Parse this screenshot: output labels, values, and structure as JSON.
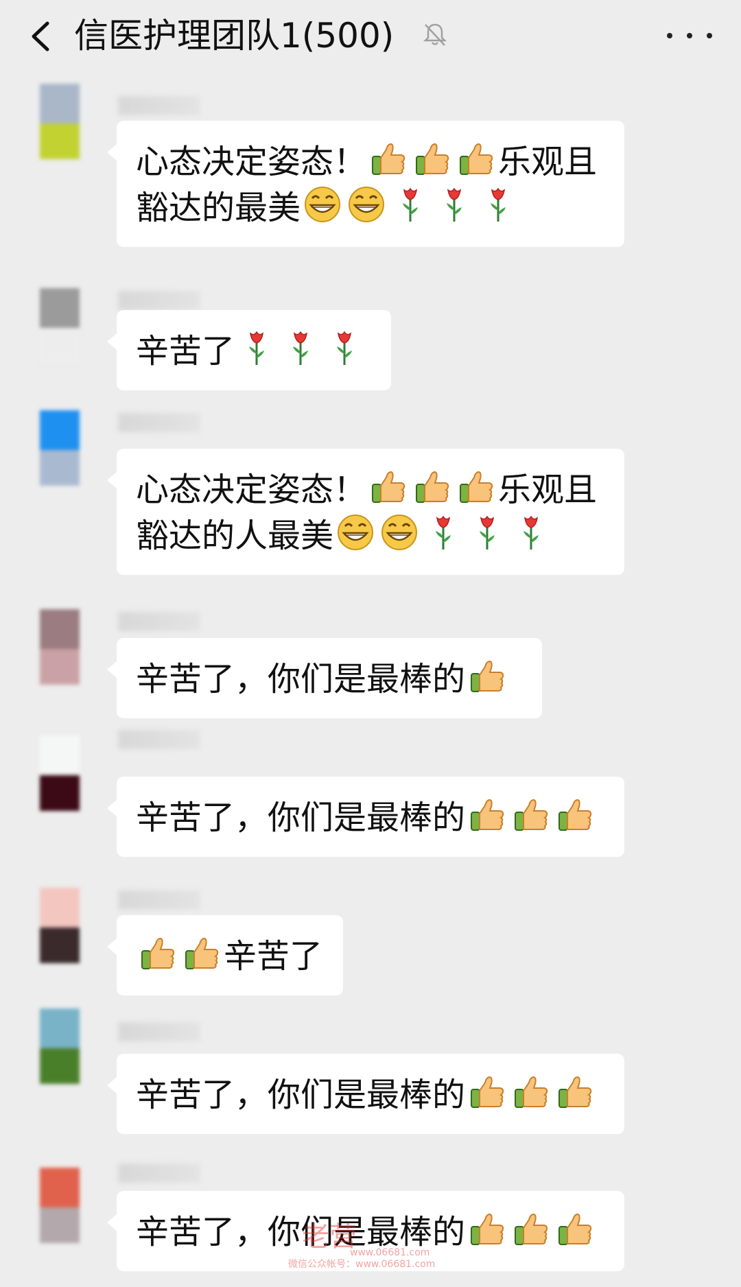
{
  "header": {
    "title": "信医护理团队1(500)",
    "back_icon": "chevron-left-icon",
    "mute_icon": "bell-off-icon",
    "more_icon": "more-dots-icon"
  },
  "messages": [
    {
      "text_before": "心态决定姿态！",
      "emojis1": [
        "thumbs-up",
        "thumbs-up",
        "thumbs-up"
      ],
      "text_mid": "乐观且\n豁达的最美",
      "emojis2": [
        "grin",
        "grin",
        "rose",
        "rose",
        "rose"
      ]
    },
    {
      "text_before": "辛苦了",
      "emojis1": [
        "rose",
        "rose",
        "rose"
      ]
    },
    {
      "text_before": "心态决定姿态！",
      "emojis1": [
        "thumbs-up",
        "thumbs-up",
        "thumbs-up"
      ],
      "text_mid": "乐观且\n豁达的人最美",
      "emojis2": [
        "grin",
        "grin",
        "rose",
        "rose",
        "rose"
      ]
    },
    {
      "text_before": "辛苦了，你们是最棒的",
      "emojis1": [
        "thumbs-up"
      ]
    },
    {
      "text_before": "辛苦了，你们是最棒的",
      "emojis1": [
        "thumbs-up",
        "thumbs-up",
        "thumbs-up"
      ]
    },
    {
      "prefix_emojis": [
        "thumbs-up",
        "thumbs-up"
      ],
      "text_before": "辛苦了"
    },
    {
      "text_before": "辛苦了，你们是最棒的",
      "emojis1": [
        "thumbs-up",
        "thumbs-up",
        "thumbs-up"
      ]
    },
    {
      "text_before": "辛苦了，你们是最棒的",
      "emojis1": [
        "thumbs-up",
        "thumbs-up",
        "thumbs-up"
      ]
    }
  ],
  "watermark": {
    "logo": "老营",
    "site": "www.06681.com",
    "caption": "微信公众帐号：www.06681.com"
  },
  "colors": {
    "background": "#ededed",
    "bubble": "#ffffff",
    "watermark": "#e3322e"
  }
}
